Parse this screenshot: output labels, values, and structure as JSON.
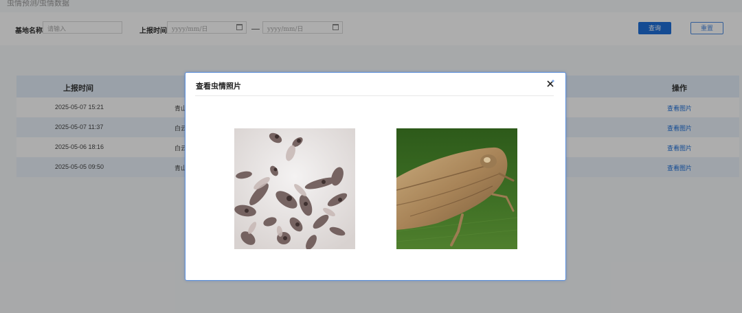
{
  "breadcrumb": "虫情预测/虫情数据",
  "filter": {
    "name_label": "基地名称:",
    "name_placeholder": "请输入",
    "time_label": "上报时间:",
    "date_start_placeholder": "yyyy/mm/日",
    "date_end_placeholder": "yyyy/mm/日",
    "search_label": "查询",
    "reset_label": "重置"
  },
  "table": {
    "col_time": "上报时间",
    "col_op": "操作",
    "rows": [
      {
        "time": "2025-05-07 15:21",
        "name": "青山",
        "op": "查看图片"
      },
      {
        "time": "2025-05-07 11:37",
        "name": "白云",
        "op": "查看图片"
      },
      {
        "time": "2025-05-06 18:16",
        "name": "白云",
        "op": "查看图片"
      },
      {
        "time": "2025-05-05 09:50",
        "name": "青山",
        "op": "查看图片"
      }
    ]
  },
  "modal": {
    "title": "查看虫情照片",
    "photos": [
      "insect-trap-photo",
      "leafhopper-closeup-photo"
    ]
  },
  "colors": {
    "primary": "#1e6fd9",
    "table_header": "#e3eef9",
    "row_alt": "#eaf2fb",
    "modal_border": "#5b8fdc"
  }
}
